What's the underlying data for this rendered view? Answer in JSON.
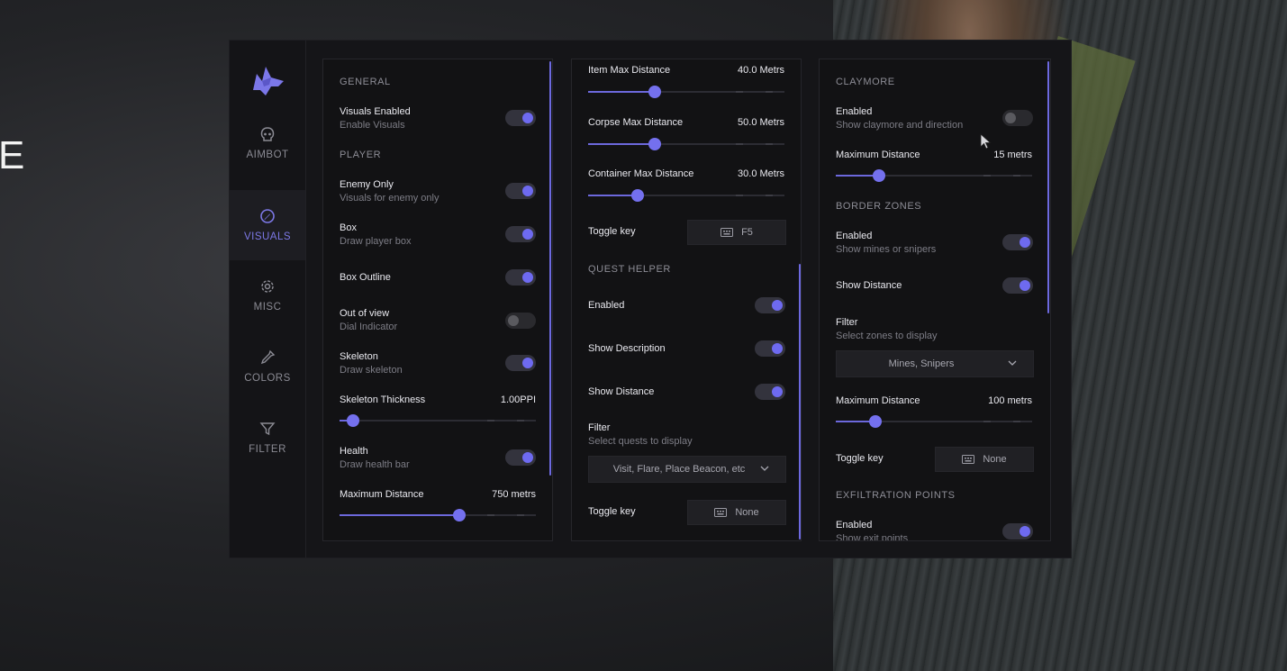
{
  "background": {
    "letter": "E"
  },
  "nav": [
    {
      "label": "AIMBOT",
      "icon": "skull-icon",
      "active": false
    },
    {
      "label": "VISUALS",
      "icon": "visuals-icon",
      "active": true
    },
    {
      "label": "MISC",
      "icon": "gear-icon",
      "active": false
    },
    {
      "label": "COLORS",
      "icon": "eyedropper-icon",
      "active": false
    },
    {
      "label": "FILTER",
      "icon": "filter-icon",
      "active": false
    }
  ],
  "colors": {
    "accent": "#6e6af0",
    "panel": "#121214",
    "window": "#151518"
  },
  "left": {
    "general_title": "GENERAL",
    "visuals_enabled": {
      "label": "Visuals Enabled",
      "sub": "Enable Visuals",
      "on": true
    },
    "player_title": "PLAYER",
    "enemy_only": {
      "label": "Enemy Only",
      "sub": "Visuals for enemy only",
      "on": true
    },
    "box": {
      "label": "Box",
      "sub": "Draw player box",
      "on": true
    },
    "box_outline": {
      "label": "Box Outline",
      "on": true
    },
    "out_of_view": {
      "label": "Out of view",
      "sub": "Dial Indicator",
      "on": false
    },
    "skeleton": {
      "label": "Skeleton",
      "sub": "Draw skeleton",
      "on": true
    },
    "skeleton_thickness": {
      "label": "Skeleton Thickness",
      "value": "1.00PPI",
      "fraction": 0.07
    },
    "health": {
      "label": "Health",
      "sub": "Draw health bar",
      "on": true
    },
    "max_distance": {
      "label": "Maximum Distance",
      "value": "750 metrs",
      "fraction": 0.61
    }
  },
  "middle": {
    "item_max": {
      "label": "Item Max Distance",
      "value": "40.0 Metrs",
      "fraction": 0.34
    },
    "corpse_max": {
      "label": "Corpse Max Distance",
      "value": "50.0 Metrs",
      "fraction": 0.34
    },
    "container_max": {
      "label": "Container Max Distance",
      "value": "30.0 Metrs",
      "fraction": 0.25
    },
    "toggle_key_1": {
      "label": "Toggle key",
      "key": "F5"
    },
    "quest_title": "QUEST HELPER",
    "quest_enabled": {
      "label": "Enabled",
      "on": true
    },
    "show_description": {
      "label": "Show Description",
      "on": true
    },
    "show_distance": {
      "label": "Show Distance",
      "on": true
    },
    "filter": {
      "label": "Filter",
      "sub": "Select quests to display",
      "selected": "Visit, Flare, Place Beacon, etc"
    },
    "toggle_key_2": {
      "label": "Toggle key",
      "key": "None"
    }
  },
  "right": {
    "claymore_title": "CLAYMORE",
    "claymore_enabled": {
      "label": "Enabled",
      "sub": "Show claymore and direction",
      "on": false
    },
    "claymore_max": {
      "label": "Maximum Distance",
      "value": "15 metrs",
      "fraction": 0.22
    },
    "border_title": "BORDER ZONES",
    "border_enabled": {
      "label": "Enabled",
      "sub": "Show mines or snipers",
      "on": true
    },
    "border_show_distance": {
      "label": "Show Distance",
      "on": true
    },
    "border_filter": {
      "label": "Filter",
      "sub": "Select zones to display",
      "selected": "Mines, Snipers"
    },
    "border_max": {
      "label": "Maximum Distance",
      "value": "100 metrs",
      "fraction": 0.2
    },
    "toggle_key": {
      "label": "Toggle key",
      "key": "None"
    },
    "exfil_title": "EXFILTRATION POINTS",
    "exfil_enabled": {
      "label": "Enabled",
      "sub": "Show exit points",
      "on": true
    }
  }
}
